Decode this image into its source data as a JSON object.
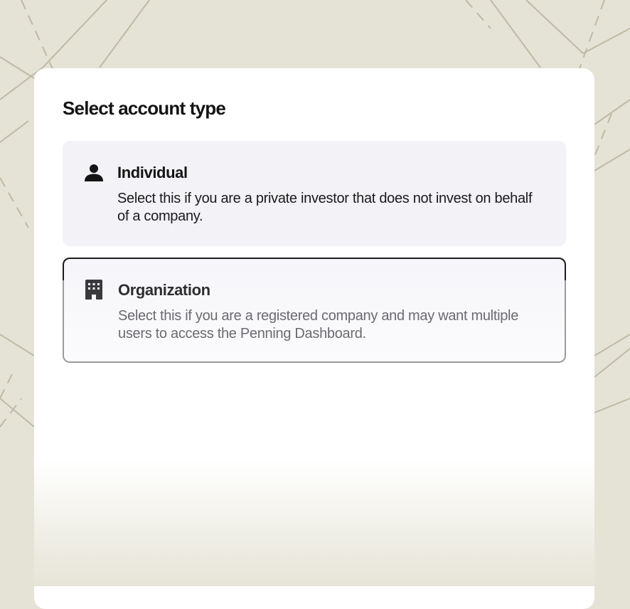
{
  "page": {
    "title": "Select account type"
  },
  "options": [
    {
      "id": "individual",
      "label": "Individual",
      "description": "Select this if you are a private investor that does not invest on behalf of a company.",
      "icon": "person-icon"
    },
    {
      "id": "organization",
      "label": "Organization",
      "description": "Select this if you are a registered company and may want multiple users to access the Penning Dashboard.",
      "icon": "building-icon"
    }
  ],
  "colors": {
    "background": "#e5e3d5",
    "pattern_line": "#bdbaa6",
    "card": "#ffffff",
    "option_bg": "#f3f2f7",
    "selected_border": "#1c1c1e",
    "muted_text": "#6b6b70"
  }
}
